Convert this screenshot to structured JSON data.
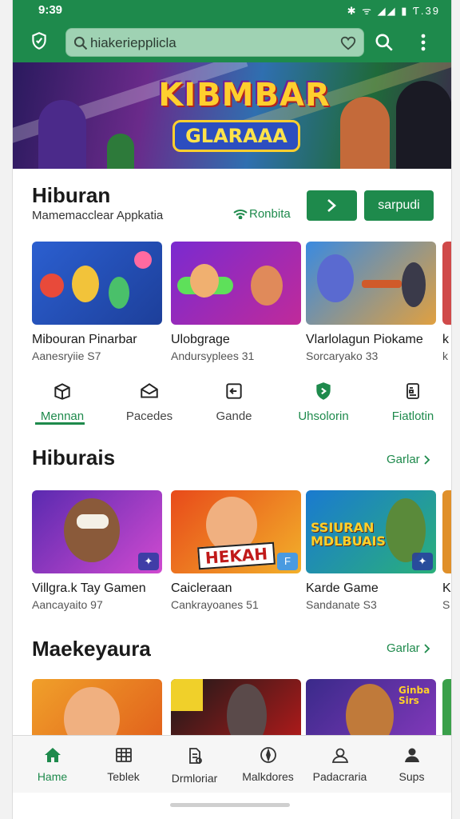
{
  "status_bar": {
    "time": "9:39",
    "icons_text": "✱ ᯤ ◢◢ ▮ Ƭ.39"
  },
  "top_bar": {
    "search_placeholder": "hiakeriepplicla",
    "search_value": "hiakeriepplicla"
  },
  "banner": {
    "title_line1": "KIBMBAR",
    "title_line2": "GLARAAA"
  },
  "featured_section": {
    "title": "Hiburan",
    "subtitle": "Mamemacclear Appkatia",
    "link_label": "Ronbita",
    "button_label": "sarpudi",
    "cards": [
      {
        "title": "Mibouran Pinarbar",
        "subtitle": "Aanesryiie S7"
      },
      {
        "title": "Ulobgrage",
        "subtitle": "Andursyplees 31"
      },
      {
        "title": "Vlarlolagun Piokame",
        "subtitle": "Sorcaryako 33"
      },
      {
        "title": "k",
        "subtitle": "k"
      }
    ]
  },
  "category_tabs": [
    {
      "label": "Mennan",
      "icon": "box-open-icon"
    },
    {
      "label": "Pacedes",
      "icon": "envelope-open-icon"
    },
    {
      "label": "Gande",
      "icon": "login-box-icon"
    },
    {
      "label": "Uhsolorin",
      "icon": "shield-heart-icon"
    },
    {
      "label": "Fiatlotin",
      "icon": "list-card-icon"
    }
  ],
  "section2": {
    "title": "Hiburais",
    "see_more": "Garlar",
    "cards": [
      {
        "title": "Villgra.k Tay Gamen",
        "subtitle": "Aancayaito 97",
        "thumb_text": ""
      },
      {
        "title": "Caicleraan",
        "subtitle": "Cankrayoanes 51",
        "thumb_text": "HEKAH"
      },
      {
        "title": "Karde Game",
        "subtitle": "Sandanate S3",
        "thumb_text": "SSIURAN MDLBUAIS"
      },
      {
        "title": "K",
        "subtitle": "S",
        "thumb_text": ""
      }
    ]
  },
  "section3": {
    "title": "Maekeyaura",
    "see_more": "Garlar",
    "cards": [
      {
        "thumb_text": ""
      },
      {
        "thumb_text": ""
      },
      {
        "thumb_text": "Ginba Sirs"
      },
      {
        "thumb_text": ""
      }
    ]
  },
  "bottom_nav": [
    {
      "label": "Hame",
      "icon": "home-icon"
    },
    {
      "label": "Teblek",
      "icon": "grid-icon"
    },
    {
      "label": "Drmloriar",
      "icon": "document-stack-icon"
    },
    {
      "label": "Malkdores",
      "icon": "compass-icon"
    },
    {
      "label": "Padacraria",
      "icon": "person-icon"
    },
    {
      "label": "Sups",
      "icon": "user-icon"
    }
  ],
  "colors": {
    "accent": "#1e8a4c",
    "search_fill": "#9fd2b3",
    "background": "#ffffff"
  }
}
